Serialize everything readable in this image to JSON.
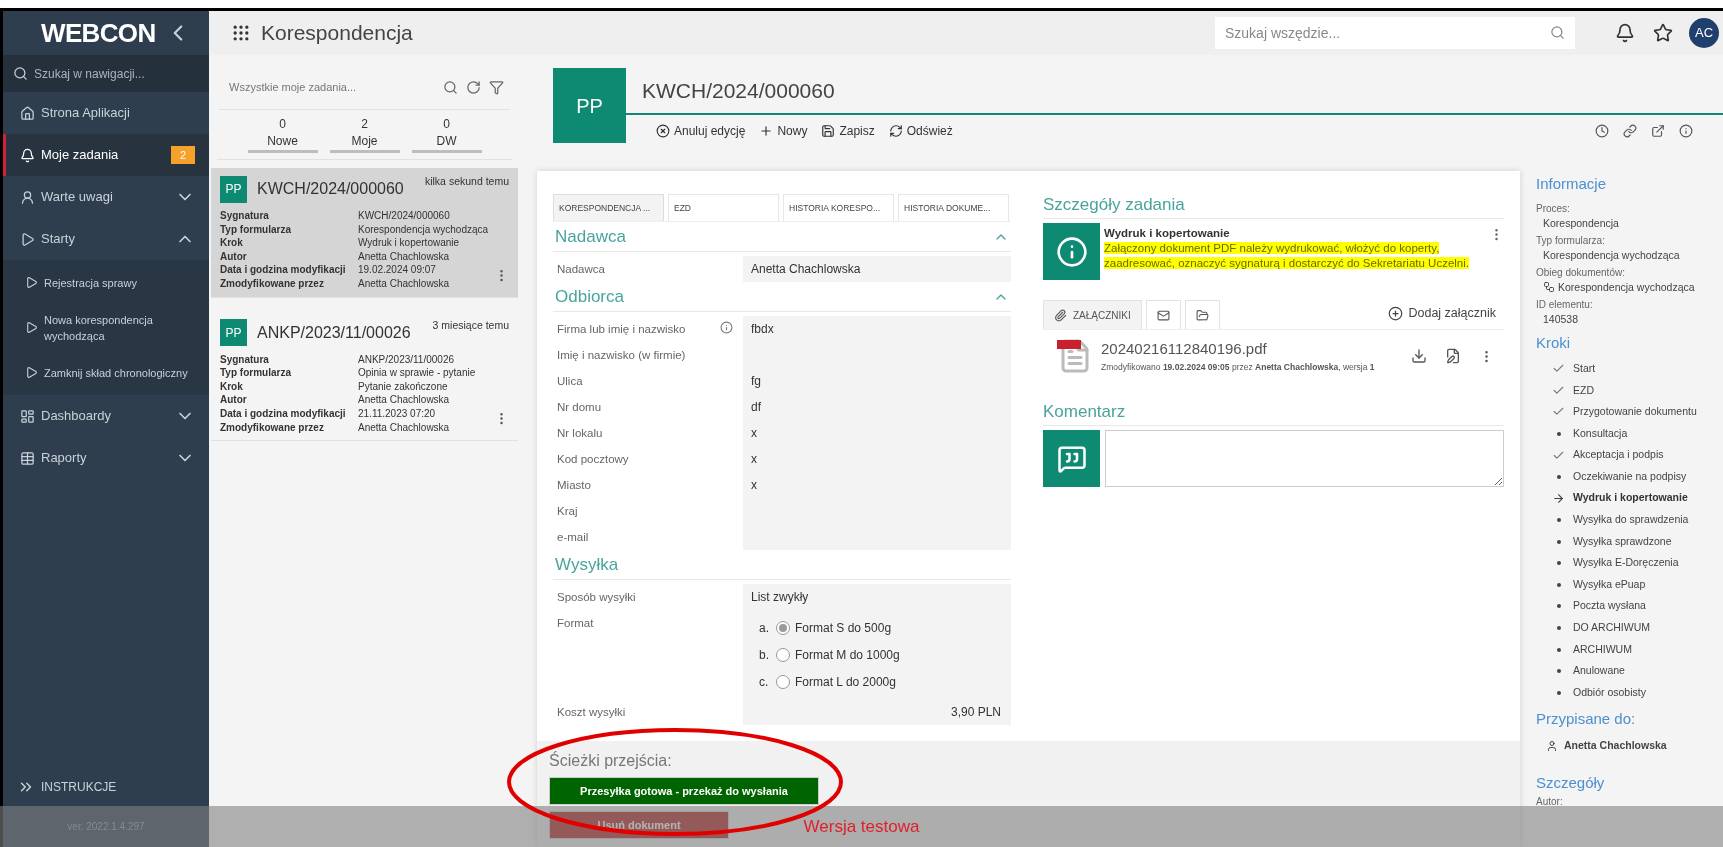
{
  "header": {
    "logo": "WEBCON",
    "app_title": "Korespondencja",
    "search": {
      "placeholder": "Szukaj wszędzie..."
    },
    "avatar": "AC"
  },
  "sidebar": {
    "search": {
      "placeholder": "Szukaj w nawigacji..."
    },
    "items": [
      {
        "label": "Strona Aplikacji",
        "kind": "link",
        "selected": false
      },
      {
        "label": "Moje zadania",
        "kind": "link",
        "selected": true,
        "badge": "2"
      },
      {
        "label": "Warte uwagi",
        "kind": "group",
        "selected": false,
        "expanded": false
      },
      {
        "label": "Starty",
        "kind": "group",
        "selected": false,
        "expanded": true,
        "children": [
          {
            "label": "Rejestracja sprawy"
          },
          {
            "label": "Nowa korespondencja wychodząca"
          },
          {
            "label": "Zamknij skład chronologiczny"
          }
        ]
      },
      {
        "label": "Dashboardy",
        "kind": "group",
        "selected": false,
        "expanded": false
      },
      {
        "label": "Raporty",
        "kind": "group",
        "selected": false,
        "expanded": false
      }
    ],
    "footer": "INSTRUKCJE",
    "version": "ver. 2022.1.4.297"
  },
  "task_list": {
    "search": {
      "placeholder": "Wszystkie moje zadania..."
    },
    "counters": [
      {
        "count": "0",
        "label": "Nowe"
      },
      {
        "count": "2",
        "label": "Moje"
      },
      {
        "count": "0",
        "label": "DW"
      }
    ],
    "tasks": [
      {
        "badge": "PP",
        "title": "KWCH/2024/000060",
        "time": "kilka sekund temu",
        "selected": true,
        "fields": [
          {
            "label": "Sygnatura",
            "value": "KWCH/2024/000060"
          },
          {
            "label": "Typ formularza",
            "value": "Korespondencja wychodząca"
          },
          {
            "label": "Krok",
            "value": "Wydruk i kopertowanie"
          },
          {
            "label": "Autor",
            "value": "Anetta Chachlowska"
          },
          {
            "label": "Data i godzina modyfikacji",
            "value": "19.02.2024 09:07"
          },
          {
            "label": "Zmodyfikowane przez",
            "value": "Anetta Chachlowska"
          }
        ]
      },
      {
        "badge": "PP",
        "title": "ANKP/2023/11/00026",
        "time": "3 miesiące temu",
        "selected": false,
        "fields": [
          {
            "label": "Sygnatura",
            "value": "ANKP/2023/11/00026"
          },
          {
            "label": "Typ formularza",
            "value": "Opinia w sprawie - pytanie"
          },
          {
            "label": "Krok",
            "value": "Pytanie zakończone"
          },
          {
            "label": "Autor",
            "value": "Anetta Chachlowska"
          },
          {
            "label": "Data i godzina modyfikacji",
            "value": "21.11.2023 07:20"
          },
          {
            "label": "Zmodyfikowane przez",
            "value": "Anetta Chachlowska"
          }
        ]
      }
    ]
  },
  "document": {
    "badge": "PP",
    "title": "KWCH/2024/000060",
    "toolbar": [
      "Anuluj edycję",
      "Nowy",
      "Zapisz",
      "Odśwież"
    ],
    "tabs": [
      {
        "label": "KORESPONDENCJA ...",
        "selected": true
      },
      {
        "label": "EZD",
        "selected": false
      },
      {
        "label": "HISTORIA KORESPO...",
        "selected": false
      },
      {
        "label": "HISTORIA DOKUME...",
        "selected": false
      }
    ],
    "sections": [
      {
        "title": "Nadawca",
        "expanded": true,
        "fields": [
          {
            "kind": "text",
            "label": "Nadawca",
            "value": "Anetta Chachlowska"
          }
        ]
      },
      {
        "title": "Odbiorca",
        "expanded": true,
        "fields": [
          {
            "kind": "text",
            "label": "Firma lub imię i nazwisko",
            "value": "fbdx",
            "info": true
          },
          {
            "kind": "text",
            "label": "Imię i nazwisko (w firmie)"
          },
          {
            "kind": "text",
            "label": "Ulica",
            "value": "fg"
          },
          {
            "kind": "text",
            "label": "Nr domu",
            "value": "df"
          },
          {
            "kind": "text",
            "label": "Nr lokalu",
            "value": "x"
          },
          {
            "kind": "text",
            "label": "Kod pocztowy",
            "value": "x"
          },
          {
            "kind": "text",
            "label": "Miasto",
            "value": "x"
          },
          {
            "kind": "text",
            "label": "Kraj"
          },
          {
            "kind": "text",
            "label": "e-mail"
          }
        ]
      },
      {
        "title": "Wysyłka",
        "fields": [
          {
            "kind": "text",
            "label": "Sposób wysyłki",
            "value": "List zwykły"
          },
          {
            "kind": "radio",
            "label": "Format",
            "options": [
              {
                "marker": "a.",
                "label": "Format S do 500g",
                "selected": true
              },
              {
                "marker": "b.",
                "label": "Format M do 1000g",
                "selected": false
              },
              {
                "marker": "c.",
                "label": "Format L do 2000g",
                "selected": false
              }
            ]
          },
          {
            "kind": "amount",
            "label": "Koszt wysyłki",
            "value": "3,90 PLN"
          }
        ]
      }
    ],
    "transitions": {
      "title": "Ścieżki przejścia:",
      "buttons": [
        {
          "label": "Przesyłka gotowa - przekaż do wysłania",
          "kind": "primary"
        },
        {
          "label": "Usuń dokument",
          "kind": "danger"
        }
      ]
    }
  },
  "task_details": {
    "title": "Szczegóły zadania",
    "step": "Wydruk i kopertowanie",
    "instruction": "Załączony dokument PDF należy wydrukować, włożyć do koperty, zaadresować, oznaczyć sygnaturą i dostarczyć do Sekretariatu Uczelni."
  },
  "attachments": {
    "tabs": [
      {
        "label": "ZAŁĄCZNIKI",
        "selected": true
      },
      {
        "selected": false
      },
      {
        "selected": false
      }
    ],
    "add": "Dodaj załącznik",
    "files": [
      {
        "name": "20240216112840196.pdf",
        "meta": "Zmodyfikowano **19.02.2024 09:05** przez **Anetta Chachlowska**, wersja **1**"
      }
    ]
  },
  "comment": {
    "title": "Komentarz"
  },
  "info_panel": {
    "title": "Informacje",
    "fields": [
      {
        "label": "Proces:",
        "value": "Korespondencja"
      },
      {
        "label": "Typ formularza:",
        "value": "Korespondencja wychodząca"
      },
      {
        "label": "Obieg dokumentów:",
        "value": "Korespondencja wychodząca",
        "kind": "workflow"
      },
      {
        "label": "ID elementu:",
        "value": "140538"
      }
    ],
    "steps_title": "Kroki",
    "steps": [
      {
        "label": "Start",
        "kind": "done"
      },
      {
        "label": "EZD",
        "kind": "done"
      },
      {
        "label": "Przygotowanie dokumentu",
        "kind": "done"
      },
      {
        "label": "Konsultacja",
        "kind": "pending"
      },
      {
        "label": "Akceptacja i podpis",
        "kind": "done"
      },
      {
        "label": "Oczekiwanie na podpisy",
        "kind": "pending"
      },
      {
        "label": "Wydruk i kopertowanie",
        "kind": "current"
      },
      {
        "label": "Wysyłka do sprawdzenia",
        "kind": "pending"
      },
      {
        "label": "Wysyłka sprawdzone",
        "kind": "pending"
      },
      {
        "label": "Wysyłka E-Doręczenia",
        "kind": "pending"
      },
      {
        "label": "Wysyłka ePuap",
        "kind": "pending"
      },
      {
        "label": "Poczta wysłana",
        "kind": "pending"
      },
      {
        "label": "DO ARCHIWUM",
        "kind": "pending"
      },
      {
        "label": "ARCHIWUM",
        "kind": "pending"
      },
      {
        "label": "Anulowane",
        "kind": "pending"
      },
      {
        "label": "Odbiór osobisty",
        "kind": "pending"
      }
    ],
    "assigned_title": "Przypisane do:",
    "assigned": "Anetta Chachlowska",
    "details_title": "Szczegóły",
    "details_label": "Autor:"
  },
  "banner": "Wersja testowa"
}
